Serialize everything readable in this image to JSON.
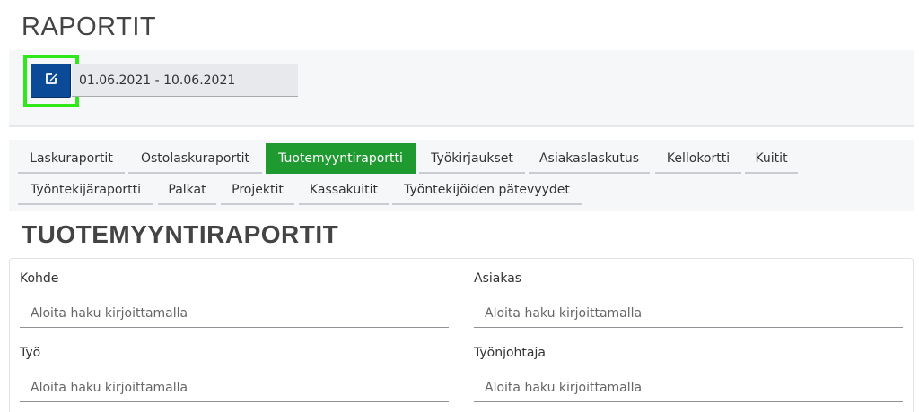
{
  "page": {
    "title": "RAPORTIT"
  },
  "date_range": {
    "value": "01.06.2021 - 10.06.2021",
    "edit_icon": "edit-icon"
  },
  "tabs": [
    {
      "label": "Laskuraportit",
      "active": false
    },
    {
      "label": "Ostolaskuraportit",
      "active": false
    },
    {
      "label": "Tuotemyyntiraportti",
      "active": true
    },
    {
      "label": "Työkirjaukset",
      "active": false
    },
    {
      "label": "Asiakaslaskutus",
      "active": false
    },
    {
      "label": "Kellokortti",
      "active": false
    },
    {
      "label": "Kuitit",
      "active": false
    },
    {
      "label": "Työntekijäraportti",
      "active": false
    },
    {
      "label": "Palkat",
      "active": false
    },
    {
      "label": "Projektit",
      "active": false
    },
    {
      "label": "Kassakuitit",
      "active": false
    },
    {
      "label": "Työntekijöiden pätevyydet",
      "active": false
    }
  ],
  "section": {
    "title": "TUOTEMYYNTIRAPORTIT"
  },
  "fields": [
    {
      "label": "Kohde",
      "placeholder": "Aloita haku kirjoittamalla"
    },
    {
      "label": "Asiakas",
      "placeholder": "Aloita haku kirjoittamalla"
    },
    {
      "label": "Työ",
      "placeholder": "Aloita haku kirjoittamalla"
    },
    {
      "label": "Työnjohtaja",
      "placeholder": "Aloita haku kirjoittamalla"
    }
  ],
  "colors": {
    "accent_green": "#1f9a31",
    "button_blue": "#0b4a97",
    "highlight_green": "#2ee81a"
  }
}
